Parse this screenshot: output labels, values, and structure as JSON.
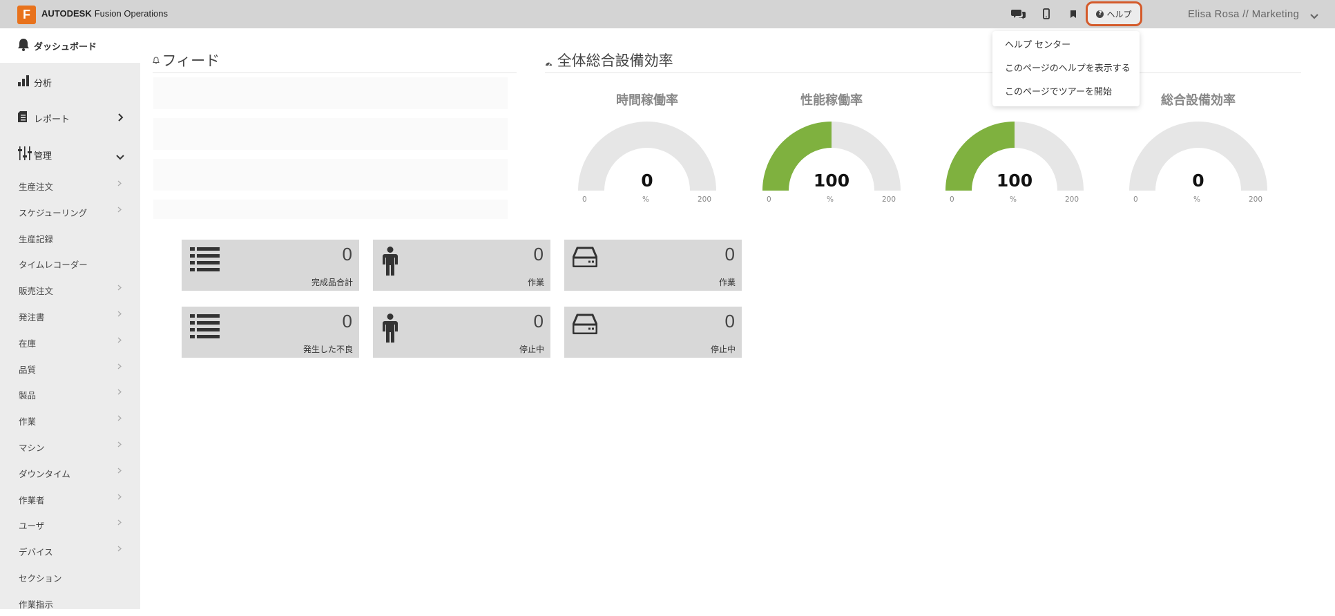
{
  "header": {
    "logo_letter": "F",
    "brand_bold": "AUTODESK",
    "brand_product": "Fusion Operations",
    "help_label": "ヘルプ",
    "user_label": "Elisa Rosa // Marketing"
  },
  "help_menu": {
    "items": [
      {
        "label": "ヘルプ センター"
      },
      {
        "label": "このページのヘルプを表示する"
      },
      {
        "label": "このページでツアーを開始"
      }
    ]
  },
  "sidebar": {
    "dashboard": "ダッシュボード",
    "analysis": "分析",
    "reports": "レポート",
    "admin": "管理",
    "sub_items": [
      {
        "label": "生産注文",
        "has_chevron": true
      },
      {
        "label": "スケジューリング",
        "has_chevron": true
      },
      {
        "label": "生産記録",
        "has_chevron": false
      },
      {
        "label": "タイムレコーダー",
        "has_chevron": false
      },
      {
        "label": "販売注文",
        "has_chevron": true
      },
      {
        "label": "発注書",
        "has_chevron": true
      },
      {
        "label": "在庫",
        "has_chevron": true
      },
      {
        "label": "品質",
        "has_chevron": true
      },
      {
        "label": "製品",
        "has_chevron": true
      },
      {
        "label": "作業",
        "has_chevron": true
      },
      {
        "label": "マシン",
        "has_chevron": true
      },
      {
        "label": "ダウンタイム",
        "has_chevron": true
      },
      {
        "label": "作業者",
        "has_chevron": true
      },
      {
        "label": "ユーザ",
        "has_chevron": true
      },
      {
        "label": "デバイス",
        "has_chevron": true
      },
      {
        "label": "セクション",
        "has_chevron": false
      },
      {
        "label": "作業指示",
        "has_chevron": false
      }
    ]
  },
  "feed": {
    "title": "フィード"
  },
  "oee": {
    "title": "全体総合設備効率",
    "gauges": [
      {
        "title": "時間稼働率",
        "value": "0",
        "unit": "%",
        "min": "0",
        "max": "200",
        "fill_fraction": 0
      },
      {
        "title": "性能稼働率",
        "value": "100",
        "unit": "%",
        "min": "0",
        "max": "200",
        "fill_fraction": 0.5
      },
      {
        "title": "",
        "value": "100",
        "unit": "%",
        "min": "0",
        "max": "200",
        "fill_fraction": 0.5
      },
      {
        "title": "総合設備効率",
        "value": "0",
        "unit": "%",
        "min": "0",
        "max": "200",
        "fill_fraction": 0
      }
    ],
    "fill_color": "#7fb13f",
    "track_color": "#e6e6e6"
  },
  "tiles": [
    {
      "icon": "list-icon",
      "value": "0",
      "label": "完成品合計"
    },
    {
      "icon": "person-icon",
      "value": "0",
      "label": "作業"
    },
    {
      "icon": "hard-drive-icon",
      "value": "0",
      "label": "作業"
    },
    {
      "icon": "list-icon",
      "value": "0",
      "label": "発生した不良"
    },
    {
      "icon": "person-icon",
      "value": "0",
      "label": "停止中"
    },
    {
      "icon": "hard-drive-icon",
      "value": "0",
      "label": "停止中"
    }
  ]
}
